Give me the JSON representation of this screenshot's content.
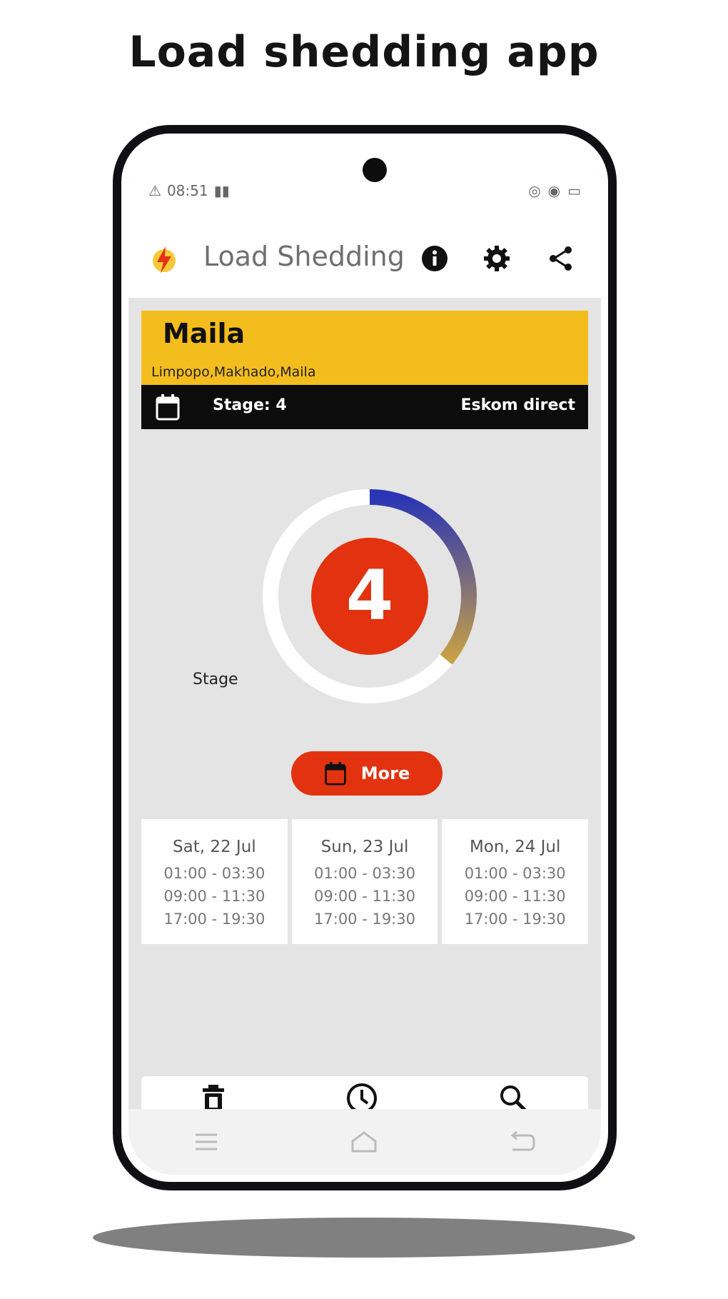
{
  "headline": "Load shedding app",
  "status_bar": {
    "time": "08:51"
  },
  "app_bar": {
    "title": "Load Shedding",
    "icons": [
      "lightning-logo-icon",
      "info-icon",
      "gear-icon",
      "share-icon"
    ]
  },
  "location": {
    "name": "Maila",
    "path": "Limpopo,Makhado,Maila"
  },
  "stage_bar": {
    "stage_label": "Stage: 4",
    "provider_label": "Eskom direct"
  },
  "gauge": {
    "stage_number": "4",
    "caption": "Stage",
    "progress_fraction": 0.36,
    "colors": {
      "start": "#2a35b5",
      "end": "#c9a145",
      "badge": "#e2320f",
      "track": "#ffffff"
    }
  },
  "more_button": {
    "label": "More"
  },
  "schedule": [
    {
      "day": "Sat, 22 Jul",
      "slots": [
        "01:00 - 03:30",
        "09:00 - 11:30",
        "17:00 - 19:30"
      ]
    },
    {
      "day": "Sun, 23 Jul",
      "slots": [
        "01:00 - 03:30",
        "09:00 - 11:30",
        "17:00 - 19:30"
      ]
    },
    {
      "day": "Mon, 24 Jul",
      "slots": [
        "01:00 - 03:30",
        "09:00 - 11:30",
        "17:00 - 19:30"
      ]
    }
  ],
  "bottom_nav": {
    "icons": [
      "delete-icon",
      "clock-icon",
      "search-icon"
    ]
  },
  "system_nav": {
    "icons": [
      "recents-icon",
      "home-icon",
      "back-icon"
    ]
  },
  "colors": {
    "accent_yellow": "#f4bd1e",
    "accent_red": "#e2320f",
    "dark": "#0c0c0c"
  }
}
